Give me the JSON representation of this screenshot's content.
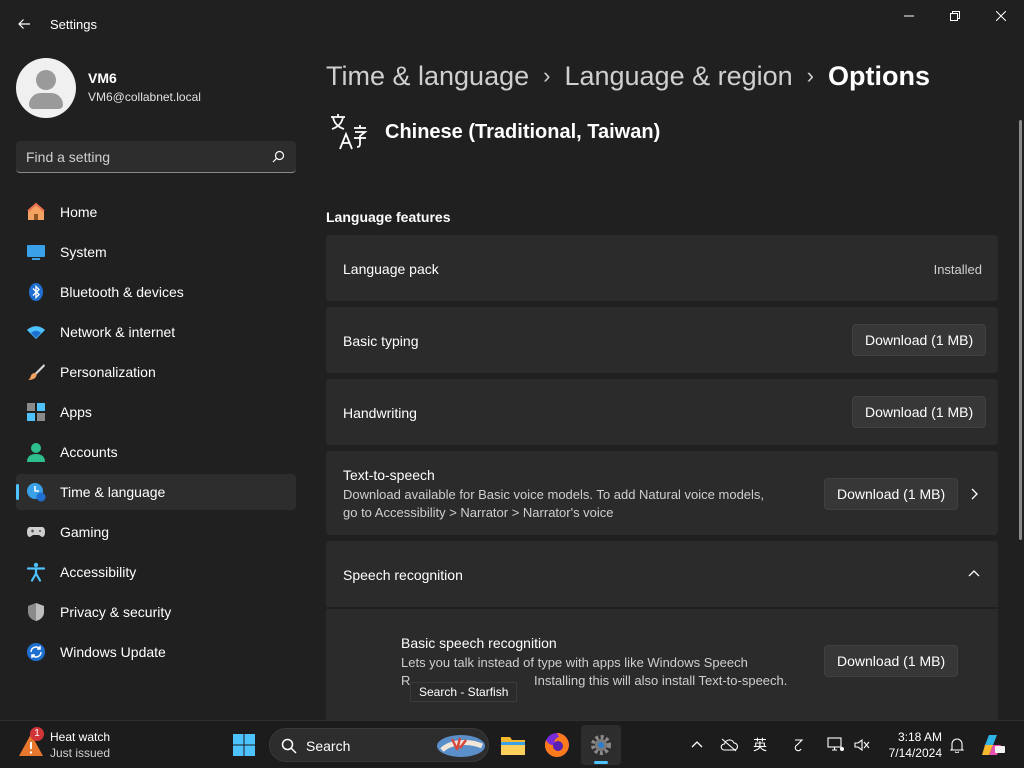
{
  "window": {
    "title": "Settings",
    "controls": {
      "minimize": "minimize",
      "restore": "restore",
      "close": "close"
    }
  },
  "profile": {
    "name": "VM6",
    "email": "VM6@collabnet.local"
  },
  "search": {
    "placeholder": "Find a setting"
  },
  "sidebar": {
    "items": [
      {
        "label": "Home",
        "icon": "home-icon"
      },
      {
        "label": "System",
        "icon": "system-icon"
      },
      {
        "label": "Bluetooth & devices",
        "icon": "bluetooth-icon"
      },
      {
        "label": "Network & internet",
        "icon": "wifi-icon"
      },
      {
        "label": "Personalization",
        "icon": "brush-icon"
      },
      {
        "label": "Apps",
        "icon": "apps-icon"
      },
      {
        "label": "Accounts",
        "icon": "accounts-icon"
      },
      {
        "label": "Time & language",
        "icon": "time-language-icon",
        "active": true
      },
      {
        "label": "Gaming",
        "icon": "gamepad-icon"
      },
      {
        "label": "Accessibility",
        "icon": "accessibility-icon"
      },
      {
        "label": "Privacy & security",
        "icon": "shield-icon"
      },
      {
        "label": "Windows Update",
        "icon": "update-icon"
      }
    ]
  },
  "breadcrumb": {
    "items": [
      "Time & language",
      "Language & region"
    ],
    "current": "Options"
  },
  "language": {
    "name": "Chinese (Traditional, Taiwan)"
  },
  "features": {
    "section_title": "Language features",
    "language_pack": {
      "title": "Language pack",
      "status": "Installed"
    },
    "basic_typing": {
      "title": "Basic typing",
      "button": "Download (1 MB)"
    },
    "handwriting": {
      "title": "Handwriting",
      "button": "Download (1 MB)"
    },
    "tts": {
      "title": "Text-to-speech",
      "desc_line1": "Download available for Basic voice models. To add Natural voice models,",
      "desc_line2": "go to Accessibility > Narrator > Narrator's voice",
      "button": "Download (1 MB)"
    },
    "speech_recognition": {
      "title": "Speech recognition"
    },
    "basic_speech": {
      "title": "Basic speech recognition",
      "desc_line1": "Lets you talk instead of type with apps like Windows Speech",
      "desc_line2": "R",
      "desc_line2b": "Installing this will also install Text-to-speech.",
      "button": "Download (1 MB)"
    }
  },
  "tooltip": {
    "text": "Search - Starfish"
  },
  "taskbar": {
    "weather": {
      "title": "Heat watch",
      "subtitle": "Just issued",
      "badge": "1"
    },
    "search_label": "Search",
    "ime_label": "英",
    "clock": {
      "time": "3:18 AM",
      "date": "7/14/2024"
    }
  },
  "colors": {
    "accent": "#4cc2ff",
    "background": "#202020",
    "card": "#2b2b2b"
  }
}
